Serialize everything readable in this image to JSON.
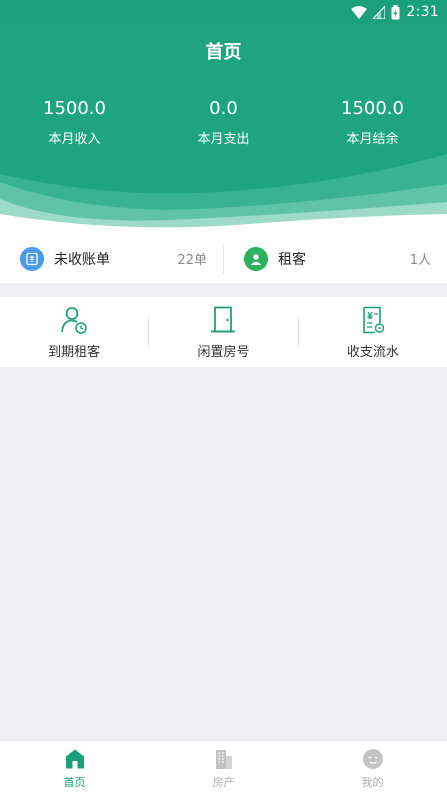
{
  "status_bar": {
    "time": "2:31"
  },
  "header": {
    "title": "首页"
  },
  "stats": [
    {
      "value": "1500.0",
      "label": "本月收入"
    },
    {
      "value": "0.0",
      "label": "本月支出"
    },
    {
      "value": "1500.0",
      "label": "本月结余"
    }
  ],
  "summary": {
    "unpaid": {
      "label": "未收账单",
      "count": "22单"
    },
    "tenants": {
      "label": "租客",
      "count": "1人"
    }
  },
  "shortcuts": [
    {
      "label": "到期租客"
    },
    {
      "label": "闲置房号"
    },
    {
      "label": "收支流水"
    }
  ],
  "tabs": [
    {
      "label": "首页"
    },
    {
      "label": "房产"
    },
    {
      "label": "我的"
    }
  ],
  "colors": {
    "primary": "#1aa07a",
    "unpaid_icon": "#4a9be8",
    "tenant_icon": "#2ab35e",
    "inactive": "#b0b0b0"
  },
  "icons": {
    "status": [
      "wifi-icon",
      "signal-icon",
      "battery-icon"
    ],
    "shortcuts": [
      "user-clock-icon",
      "door-icon",
      "ledger-icon"
    ],
    "tabs": [
      "home-icon",
      "building-icon",
      "profile-icon"
    ]
  }
}
